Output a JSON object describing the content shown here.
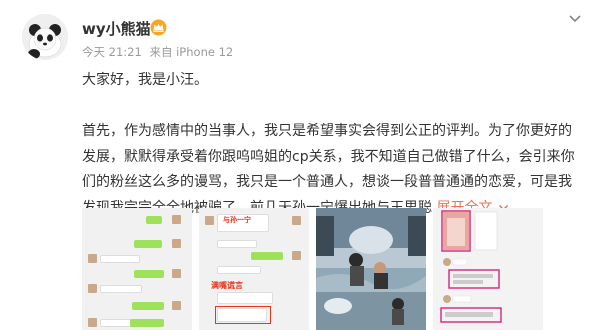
{
  "post": {
    "author": "wy小熊猫",
    "meta": {
      "time": "今天 21:21",
      "source": "来自 iPhone 12"
    },
    "text_lines": [
      "大家好，我是小汪。",
      "",
      "首先，作为感情中的当事人，我只是希望事实会得到公正的评判。为了你更好的",
      "发展，默默得承受着你跟呜呜姐的cp关系，我不知道自己做错了什么，会引来你",
      "们的粉丝这么多的谩骂，我只是一个普通人，想谈一段普普通通的恋爱，可是我",
      "发现我完完全全地被骗了。前几天孙一宁爆出她与王思聪 "
    ],
    "expand_label": "展开全文",
    "images": [
      {
        "name": "chat-screenshot-1",
        "labels": []
      },
      {
        "name": "chat-screenshot-2",
        "labels": [
          "与孙一宁",
          "满嘴谎言"
        ]
      },
      {
        "name": "skydiving-photo",
        "labels": []
      },
      {
        "name": "chat-screenshot-3",
        "labels": []
      }
    ]
  },
  "colors": {
    "accent": "#eb7350",
    "text": "#333333",
    "meta": "#999999",
    "highlight_red": "#e8341c",
    "chat_green": "#9de25a"
  },
  "icons": {
    "badge": "crown-vip-icon",
    "menu": "chevron-down-icon",
    "expand": "chevron-down-icon"
  }
}
